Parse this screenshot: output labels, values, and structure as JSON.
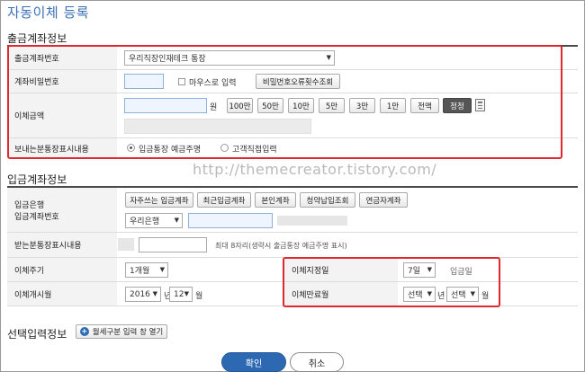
{
  "page": {
    "title": "자동이체 등록"
  },
  "withdraw": {
    "section_title": "출금계좌정보",
    "account_label": "출금계좌번호",
    "account_value": "우리직장인재테크 통장",
    "password_label": "계좌비밀번호",
    "mouse_input_label": "마우스로 입력",
    "pw_error_button": "비밀번호오류횟수조회",
    "amount_label": "이체금액",
    "amount_unit": "원",
    "amount_buttons": [
      "100만",
      "50만",
      "10만",
      "5만",
      "3만",
      "1만",
      "전액",
      "정정"
    ],
    "memo_label": "보내는분통장표시내용",
    "memo_option_default": "입금통장 예금주명",
    "memo_option_custom": "고객직접입력"
  },
  "watermark": "http://themecreator.tistory.com/",
  "deposit": {
    "section_title": "입금계좌정보",
    "bank_label_line1": "입금은행",
    "bank_label_line2": "입금계좌번호",
    "quick_buttons": [
      "자주쓰는 입금계좌",
      "최근입금계좌",
      "본인계좌",
      "청약납입조회",
      "연금자계좌"
    ],
    "bank_value": "우리은행",
    "receiver_memo_label": "받는분통장표시내용",
    "receiver_memo_hint": "최대 8자리(생략시 출금통장 예금주명 표시)",
    "cycle_label": "이체주기",
    "cycle_value": "1개월",
    "start_label": "이체개시월",
    "start_year": "2016",
    "year_unit": "년",
    "start_month": "12",
    "month_unit": "월",
    "transfer_day_label": "이체지정일",
    "transfer_day_value": "7일",
    "transfer_day_suffix": "입금일",
    "end_label": "이체만료월",
    "end_year": "선택",
    "end_month": "선택"
  },
  "optional": {
    "section_title": "선택입력정보",
    "open_button": "월세구분 입력 창 열기"
  },
  "actions": {
    "confirm": "확인",
    "cancel": "취소"
  },
  "colors": {
    "accent": "#2d69b3",
    "highlight": "#e0282e"
  }
}
